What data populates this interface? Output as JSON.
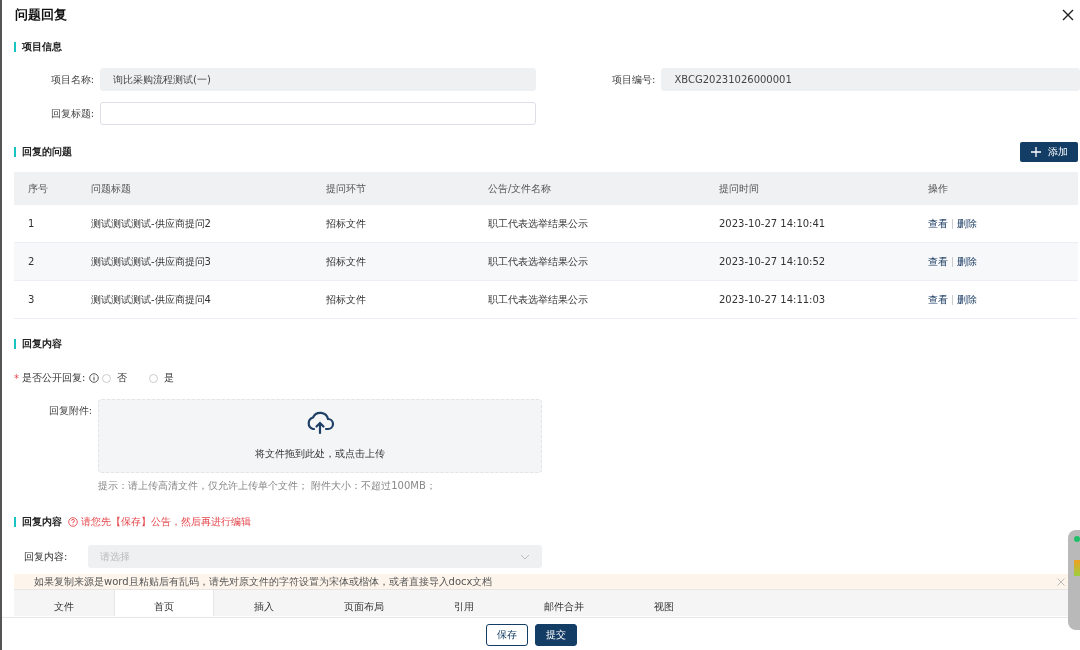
{
  "dialog": {
    "title": "问题回复"
  },
  "project_info": {
    "heading": "项目信息",
    "fields": [
      {
        "label": "项目名称:",
        "value": "询比采购流程测试(一)"
      },
      {
        "label": "项目编号:",
        "value": "XBCG20231026000001"
      }
    ],
    "reply_title": {
      "label": "回复标题:"
    }
  },
  "questions": {
    "heading": "回复的问题",
    "add_button": "添加",
    "columns": [
      "序号",
      "问题标题",
      "提问环节",
      "公告/文件名称",
      "提问时间",
      "操作"
    ],
    "rows": [
      {
        "cells": [
          "1",
          "测试测试测试-供应商提问2",
          "招标文件",
          "职工代表选举结果公示",
          "2023-10-27 14:10:41"
        ],
        "actions": [
          "查看",
          "删除"
        ]
      },
      {
        "cells": [
          "2",
          "测试测试测试-供应商提问3",
          "招标文件",
          "职工代表选举结果公示",
          "2023-10-27 14:10:52"
        ],
        "actions": [
          "查看",
          "删除"
        ]
      },
      {
        "cells": [
          "3",
          "测试测试测试-供应商提问4",
          "招标文件",
          "职工代表选举结果公示",
          "2023-10-27 14:11:03"
        ],
        "actions": [
          "查看",
          "删除"
        ]
      }
    ]
  },
  "reply_content": {
    "heading": "回复内容",
    "public_reply": {
      "label": "是否公开回复:",
      "required_mark": "*",
      "options": [
        {
          "label": "否",
          "selected": false
        },
        {
          "label": "是",
          "selected": false
        }
      ]
    },
    "attachment": {
      "label": "回复附件:",
      "upload_text": "将文件拖到此处，或点击上传",
      "hint": "提示：请上传高清文件，仅允许上传单个文件；  附件大小：不超过100MB；"
    }
  },
  "reply_editor": {
    "heading": "回复内容",
    "warning": "请您先【保存】公告，然后再进行编辑",
    "select": {
      "label": "回复内容:",
      "placeholder": "请选择"
    },
    "notice": "如果复制来源是word且粘贴后有乱码，请先对原文件的字符设置为宋体或楷体，或者直接导入docx文档",
    "tabs": [
      {
        "label": "文件",
        "selected": false
      },
      {
        "label": "首页",
        "selected": true
      },
      {
        "label": "插入",
        "selected": false
      },
      {
        "label": "页面布局",
        "selected": false
      },
      {
        "label": "引用",
        "selected": false
      },
      {
        "label": "邮件合并",
        "selected": false
      },
      {
        "label": "视图",
        "selected": false
      }
    ]
  },
  "footer": {
    "buttons": [
      {
        "label": "保存",
        "kind": "secondary"
      },
      {
        "label": "提交",
        "kind": "primary"
      }
    ]
  }
}
